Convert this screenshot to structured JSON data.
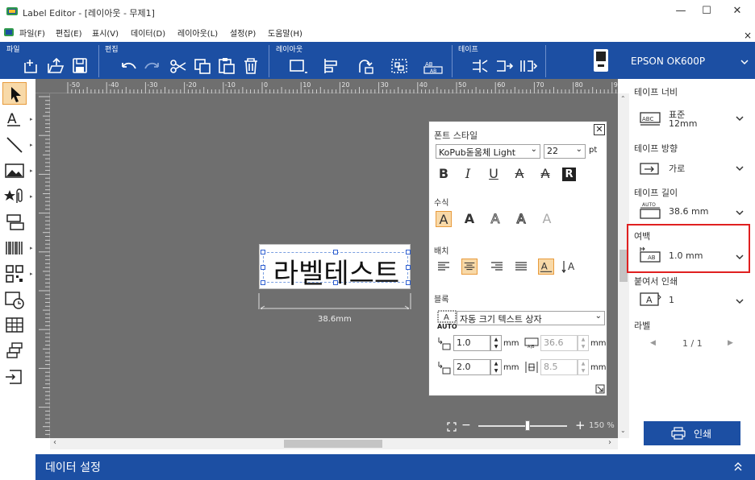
{
  "window": {
    "title": "Label Editor - [레이아웃 - 무제1]",
    "minimize": "—",
    "maximize": "☐",
    "close": "✕",
    "doc_close": "×"
  },
  "menu": [
    "파일(F)",
    "편집(E)",
    "표시(V)",
    "데이터(D)",
    "레이아웃(L)",
    "설정(P)",
    "도움말(H)"
  ],
  "ribbon": {
    "groups": [
      "파일",
      "편집",
      "레이아웃",
      "테이프"
    ],
    "printer": "EPSON OK600P"
  },
  "ruler": {
    "labels": [
      "-50",
      "-40",
      "-30",
      "-20",
      "-10",
      "0",
      "10",
      "20",
      "30",
      "40",
      "50",
      "60",
      "70",
      "80",
      "90"
    ]
  },
  "label": {
    "text": "라벨테스트",
    "width_text": "38.6mm"
  },
  "zoom": {
    "minus": "−",
    "plus": "+",
    "value": "150 %",
    "level": 0.55
  },
  "font_panel": {
    "title": "폰트 스타일",
    "font": "KoPub돋움체 Light",
    "size": "22",
    "unit": "pt",
    "styles": [
      "B",
      "I",
      "U",
      "A",
      "A",
      "R"
    ],
    "effects_title": "수식",
    "effects": [
      "A",
      "A",
      "A",
      "A",
      "A"
    ],
    "align_title": "배치",
    "fit_title": "블록",
    "fit_mode": "자동 크기 텍스트 상자",
    "auto": "AUTO",
    "fields": [
      {
        "value": "1.0",
        "unit": "mm",
        "enabled": true
      },
      {
        "value": "36.6",
        "unit": "mm",
        "enabled": false
      },
      {
        "value": "2.0",
        "unit": "mm",
        "enabled": true
      },
      {
        "value": "8.5",
        "unit": "mm",
        "enabled": false
      }
    ]
  },
  "right_panel": {
    "tape_width": {
      "label": "테이프 너비",
      "value1": "표준",
      "value2": "12mm",
      "icon_text": "ABC"
    },
    "tape_direction": {
      "label": "테이프 방향",
      "value": "가로"
    },
    "tape_length": {
      "label": "테이프 길이",
      "value": "38.6 mm",
      "icon_text": "AUTO"
    },
    "margin": {
      "label": "여백",
      "value": "1.0 mm",
      "icon_text": "AB"
    },
    "copies": {
      "label": "붙여서 인쇄",
      "value": "1",
      "icon_text": "A"
    },
    "labels": {
      "label": "라벨",
      "value": "1 / 1"
    },
    "print_button": "인쇄"
  },
  "bottom": {
    "title": "데이터 설정"
  },
  "colors": {
    "ribbon": "#1c4fa3",
    "canvas": "#6f6f6f",
    "highlight": "#e02020",
    "accent_btn": "#1c4fa3"
  }
}
